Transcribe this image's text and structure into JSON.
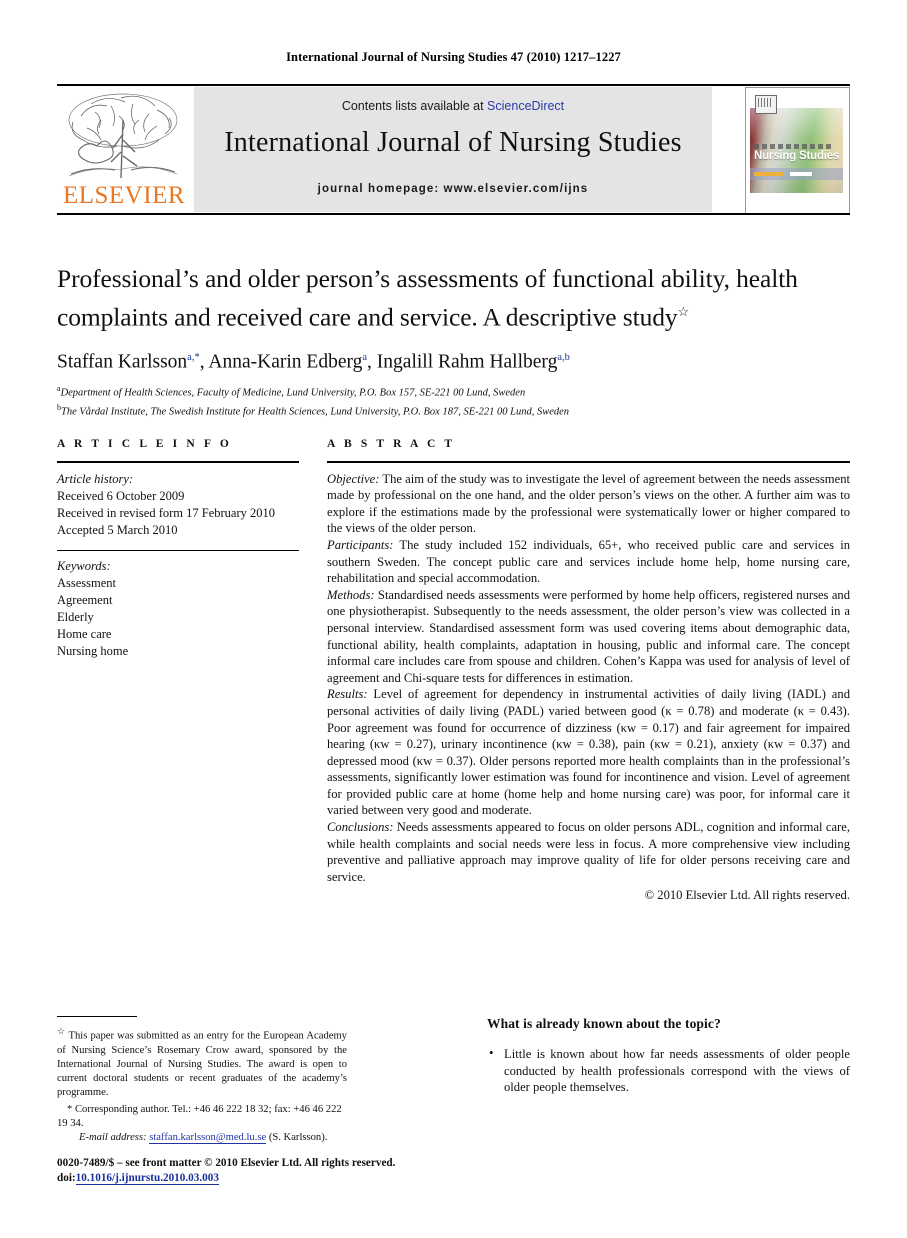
{
  "running_head": "International Journal of Nursing Studies 47 (2010) 1217–1227",
  "masthead": {
    "contents_prefix": "Contents lists available at ",
    "contents_link": "ScienceDirect",
    "journal_title": "International Journal of Nursing Studies",
    "homepage": "journal homepage: www.elsevier.com/ijns",
    "publisher_logo_word": "ELSEVIER",
    "cover_title": "Nursing Studies",
    "link_color": "#2d3aa8",
    "logo_color": "#E87722"
  },
  "article": {
    "title": "Professional’s and older person’s assessments of functional ability, health complaints and received care and service. A descriptive study",
    "title_marker": "☆",
    "authors": [
      {
        "name": "Staffan Karlsson",
        "sup": "a,*"
      },
      {
        "name": "Anna-Karin Edberg",
        "sup": "a"
      },
      {
        "name": "Ingalill Rahm Hallberg",
        "sup": "a,b"
      }
    ],
    "affiliations": [
      {
        "mark": "a",
        "text": "Department of Health Sciences, Faculty of Medicine, Lund University, P.O. Box 157, SE-221 00 Lund, Sweden"
      },
      {
        "mark": "b",
        "text": "The Vårdal Institute, The Swedish Institute for Health Sciences, Lund University, P.O. Box 187, SE-221 00 Lund, Sweden"
      }
    ]
  },
  "article_info": {
    "heading": "A R T I C L E   I N F O",
    "history_label": "Article history:",
    "history": [
      "Received 6 October 2009",
      "Received in revised form 17 February 2010",
      "Accepted 5 March 2010"
    ],
    "keywords_label": "Keywords:",
    "keywords": [
      "Assessment",
      "Agreement",
      "Elderly",
      "Home care",
      "Nursing home"
    ]
  },
  "abstract": {
    "heading": "A B S T R A C T",
    "sections": [
      {
        "label": "Objective:",
        "text": " The aim of the study was to investigate the level of agreement between the needs assessment made by professional on the one hand, and the older person’s views on the other. A further aim was to explore if the estimations made by the professional were systematically lower or higher compared to the views of the older person."
      },
      {
        "label": "Participants:",
        "text": " The study included 152 individuals, 65+, who received public care and services in southern Sweden. The concept public care and services include home help, home nursing care, rehabilitation and special accommodation."
      },
      {
        "label": "Methods:",
        "text": " Standardised needs assessments were performed by home help officers, registered nurses and one physiotherapist. Subsequently to the needs assessment, the older person’s view was collected in a personal interview. Standardised assessment form was used covering items about demographic data, functional ability, health complaints, adaptation in housing, public and informal care. The concept informal care includes care from spouse and children. Cohen’s Kappa was used for analysis of level of agreement and Chi-square tests for differences in estimation."
      },
      {
        "label": "Results:",
        "text": "  Level of agreement for dependency in instrumental activities of daily living (IADL) and personal activities of daily living (PADL) varied between good (κ = 0.78) and moderate (κ = 0.43). Poor agreement was found for occurrence of dizziness (κw = 0.17) and fair agreement for impaired hearing (κw = 0.27), urinary incontinence (κw = 0.38), pain (κw = 0.21), anxiety (κw = 0.37) and depressed mood (κw = 0.37). Older persons reported more health complaints than in the professional’s assessments, significantly lower estimation was found for incontinence and vision. Level of agreement for provided public care at home (home help and home nursing care) was poor, for informal care it varied between very good and moderate."
      },
      {
        "label": "Conclusions:",
        "text": " Needs assessments appeared to focus on older persons ADL, cognition and informal care, while health complaints and social needs were less in focus. A more comprehensive view including preventive and palliative approach may improve quality of life for older persons receiving care and service."
      }
    ],
    "copyright": "© 2010 Elsevier Ltd. All rights reserved."
  },
  "footnotes": {
    "star_mark": "☆",
    "star_note": "This paper was submitted as an entry for the European Academy of Nursing Science’s Rosemary Crow award, sponsored by the International Journal of Nursing Studies. The award is open to current doctoral students or recent graduates of the academy’s programme.",
    "corresponding_mark": "*",
    "corresponding": "Corresponding author. Tel.: +46 46 222 18 32; fax: +46 46 222 19 34.",
    "email_label": "E-mail address:",
    "email": "staffan.karlsson@med.lu.se",
    "email_owner": "(S. Karlsson)."
  },
  "footer": {
    "issn_line": "0020-7489/$ – see front matter © 2010 Elsevier Ltd. All rights reserved.",
    "doi_label": "doi:",
    "doi_value": "10.1016/j.ijnurstu.2010.03.003"
  },
  "known_box": {
    "title": "What is already known about the topic?",
    "items": [
      "Little is known about how far needs assessments of older people conducted by health professionals correspond with the views of older people themselves."
    ]
  }
}
